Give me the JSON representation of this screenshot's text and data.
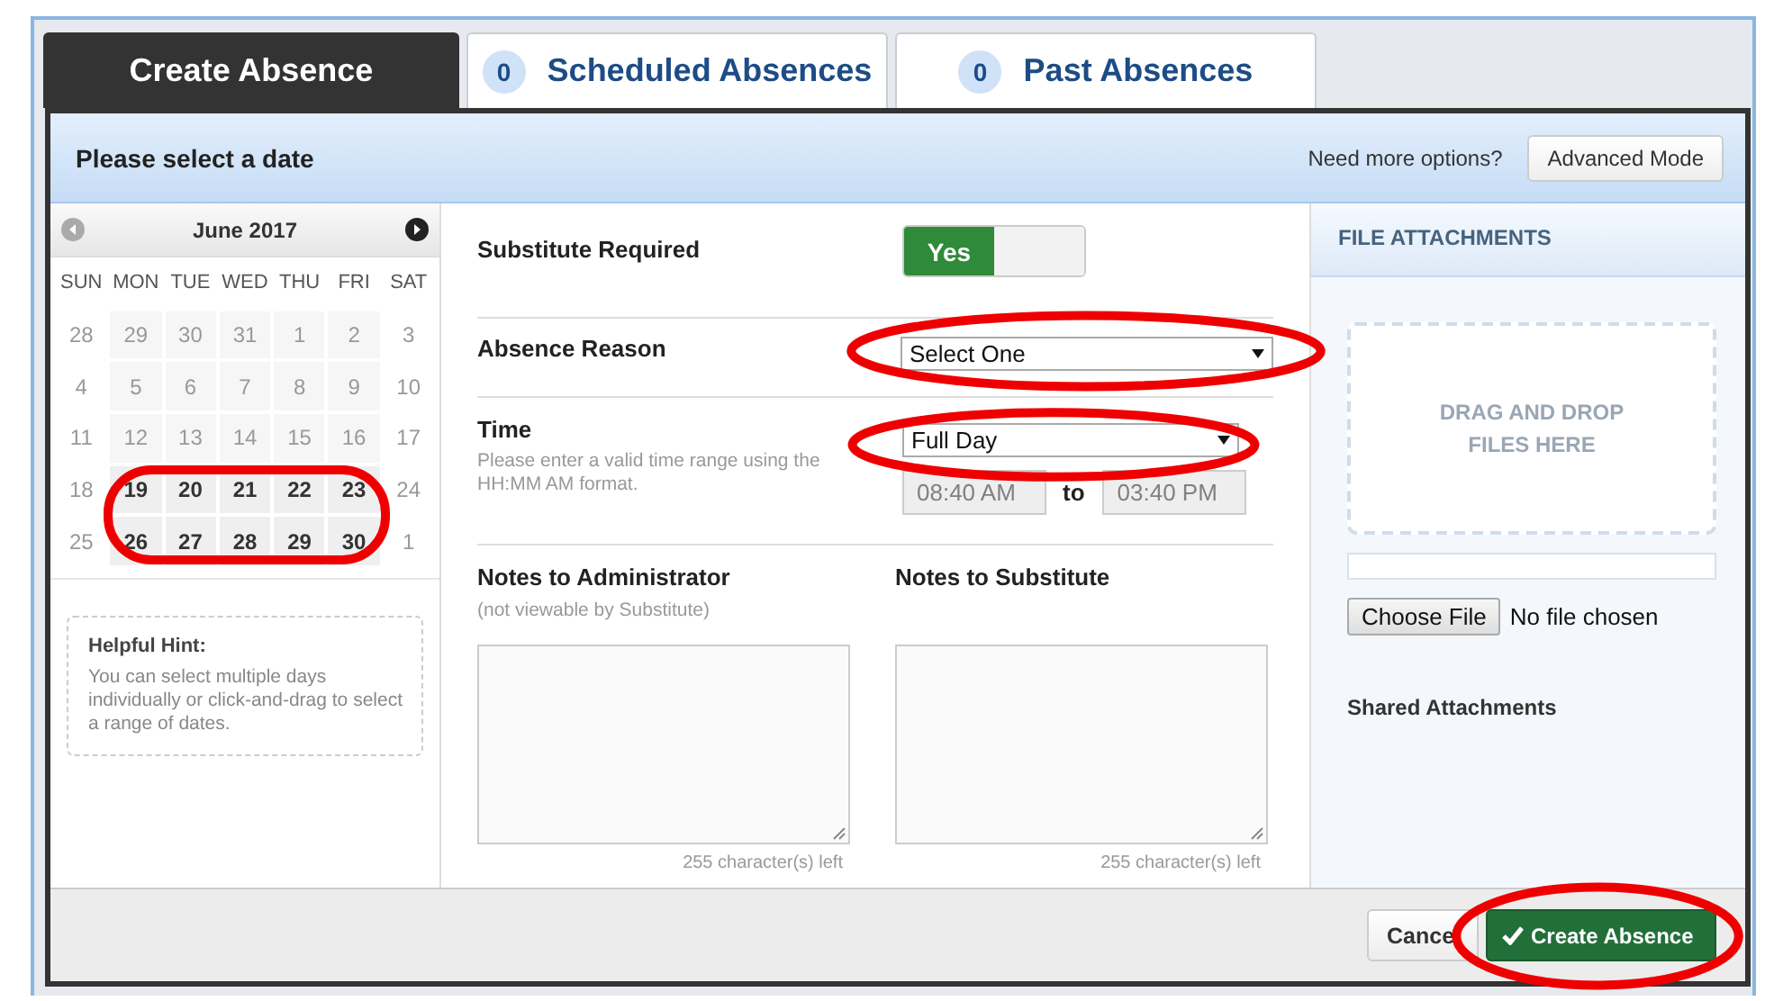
{
  "tabs": [
    {
      "label": "Create Absence",
      "selected": true
    },
    {
      "count": "0",
      "label": "Scheduled Absences",
      "selected": false
    },
    {
      "count": "0",
      "label": "Past Absences",
      "selected": false
    }
  ],
  "header": {
    "title": "Please select a date",
    "options_text": "Need more options?",
    "mode_button": "Advanced Mode"
  },
  "calendar": {
    "month": "June 2017",
    "prev_disabled": true,
    "next_disabled": false,
    "circled": true,
    "weekdays": [
      "SUN",
      "MON",
      "TUE",
      "WED",
      "THU",
      "FRI",
      "SAT"
    ],
    "weeks": [
      [
        {
          "label": "28",
          "enabled": false
        },
        {
          "label": "29",
          "enabled": false
        },
        {
          "label": "30",
          "enabled": false
        },
        {
          "label": "31",
          "enabled": false
        },
        {
          "label": "1",
          "enabled": false
        },
        {
          "label": "2",
          "enabled": false
        },
        {
          "label": "3",
          "enabled": false
        }
      ],
      [
        {
          "label": "4",
          "enabled": false
        },
        {
          "label": "5",
          "enabled": false
        },
        {
          "label": "6",
          "enabled": false
        },
        {
          "label": "7",
          "enabled": false
        },
        {
          "label": "8",
          "enabled": false
        },
        {
          "label": "9",
          "enabled": false
        },
        {
          "label": "10",
          "enabled": false
        }
      ],
      [
        {
          "label": "11",
          "enabled": false
        },
        {
          "label": "12",
          "enabled": false
        },
        {
          "label": "13",
          "enabled": false
        },
        {
          "label": "14",
          "enabled": false
        },
        {
          "label": "15",
          "enabled": false
        },
        {
          "label": "16",
          "enabled": false
        },
        {
          "label": "17",
          "enabled": false
        }
      ],
      [
        {
          "label": "18",
          "enabled": false
        },
        {
          "label": "19",
          "enabled": true
        },
        {
          "label": "20",
          "enabled": true
        },
        {
          "label": "21",
          "enabled": true
        },
        {
          "label": "22",
          "enabled": true
        },
        {
          "label": "23",
          "enabled": true
        },
        {
          "label": "24",
          "enabled": false
        }
      ],
      [
        {
          "label": "25",
          "enabled": false
        },
        {
          "label": "26",
          "enabled": true
        },
        {
          "label": "27",
          "enabled": true
        },
        {
          "label": "28",
          "enabled": true
        },
        {
          "label": "29",
          "enabled": true
        },
        {
          "label": "30",
          "enabled": true
        },
        {
          "label": "1",
          "enabled": false
        }
      ]
    ]
  },
  "hint": {
    "title": "Helpful Hint:",
    "text": "You can select multiple days individually or click-and-drag to select a range of dates."
  },
  "form": {
    "substitute_required": {
      "label": "Substitute Required",
      "toggle_text": "Yes",
      "on": true
    },
    "absence_reason": {
      "label": "Absence Reason",
      "value": "Select One",
      "circled": true
    },
    "time": {
      "label": "Time",
      "hint": "Please enter a valid time range using the HH:MM AM format.",
      "value": "Full Day",
      "circled": true,
      "start": "08:40 AM",
      "separator": "to",
      "end": "03:40 PM"
    },
    "notes": [
      {
        "label": "Notes to Administrator",
        "sublabel": "(not viewable by Substitute)",
        "remaining": "255 character(s) left"
      },
      {
        "label": "Notes to Substitute",
        "remaining": "255 character(s) left"
      }
    ]
  },
  "attachments": {
    "title": "FILE ATTACHMENTS",
    "drop_text": "DRAG AND DROP FILES HERE",
    "level": 0,
    "choose_button": "Choose File",
    "file_status": "No file chosen",
    "shared_title": "Shared Attachments"
  },
  "footer": {
    "cancel": "Cance",
    "submit": {
      "label": "Create Absence",
      "circled": true
    }
  }
}
